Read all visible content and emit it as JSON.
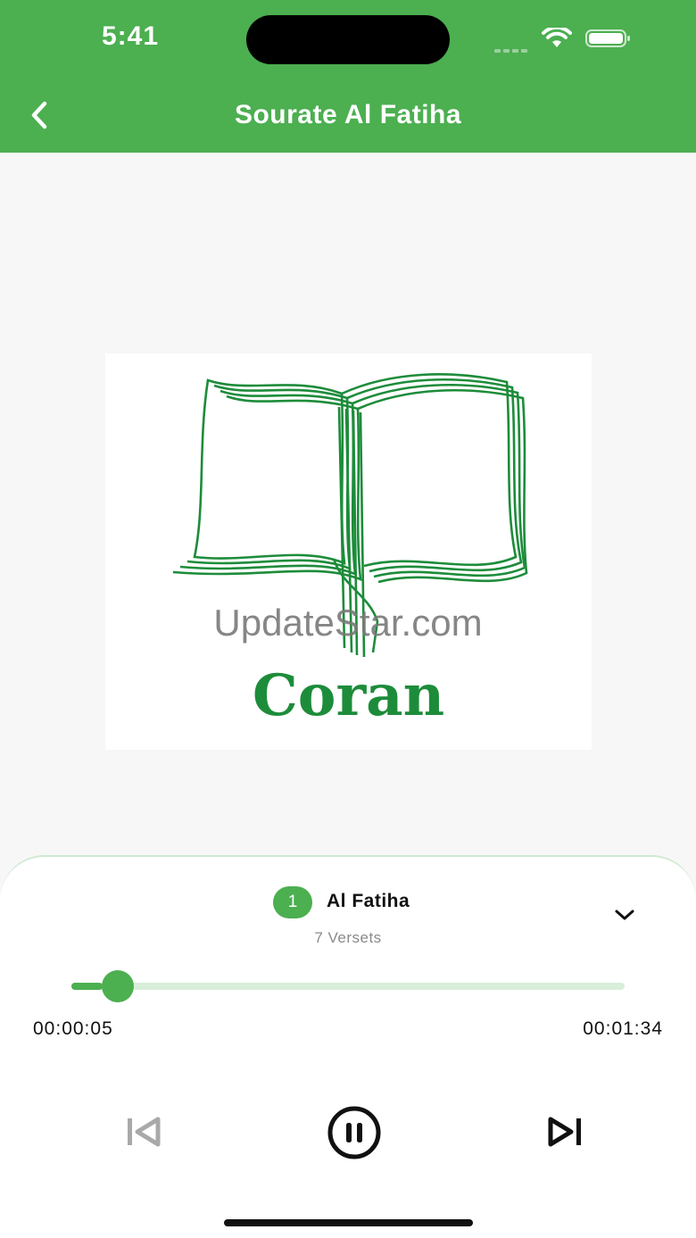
{
  "status_bar": {
    "time": "5:41"
  },
  "header": {
    "title": "Sourate Al Fatiha",
    "background": "#4caf50"
  },
  "artwork": {
    "watermark": "UpdateStar.com",
    "logo_text": "Coran"
  },
  "player": {
    "surah_number": "1",
    "surah_name": "Al Fatiha",
    "verses": "7 Versets",
    "elapsed": "00:00:05",
    "duration": "00:01:34",
    "progress_fraction": 0.057
  },
  "colors": {
    "accent": "#4caf50",
    "track": "#d8eed9",
    "logo_green": "#1d8c3a"
  },
  "icons": {
    "back": "chevron-left-icon",
    "collapse": "chevron-down-icon",
    "previous": "skip-previous-icon",
    "pause": "pause-circle-icon",
    "next": "skip-next-icon"
  }
}
